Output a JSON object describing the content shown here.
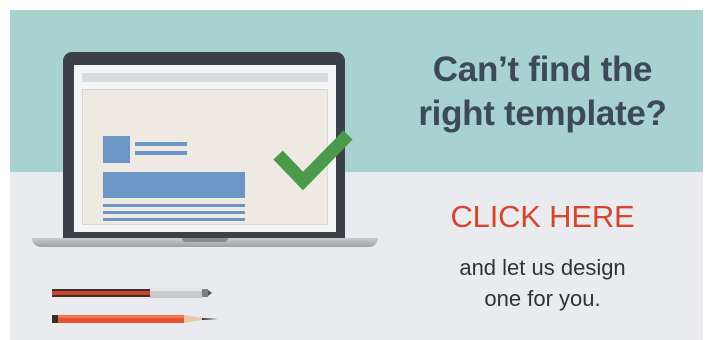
{
  "banner": {
    "headline_line1": "Can’t find the",
    "headline_line2": "right template?",
    "cta_label": "CLICK HERE",
    "subtext_line1": "and let us design",
    "subtext_line2": "one for you."
  },
  "icons": {
    "laptop": "laptop-icon",
    "checkmark": "checkmark-icon",
    "pen": "pen-icon",
    "pencil": "pencil-icon"
  },
  "colors": {
    "top_background": "#a8d2cf",
    "bottom_background": "#e9ebef",
    "headline": "#3b4a56",
    "cta": "#d4472d",
    "checkmark": "#4b9a4a"
  }
}
